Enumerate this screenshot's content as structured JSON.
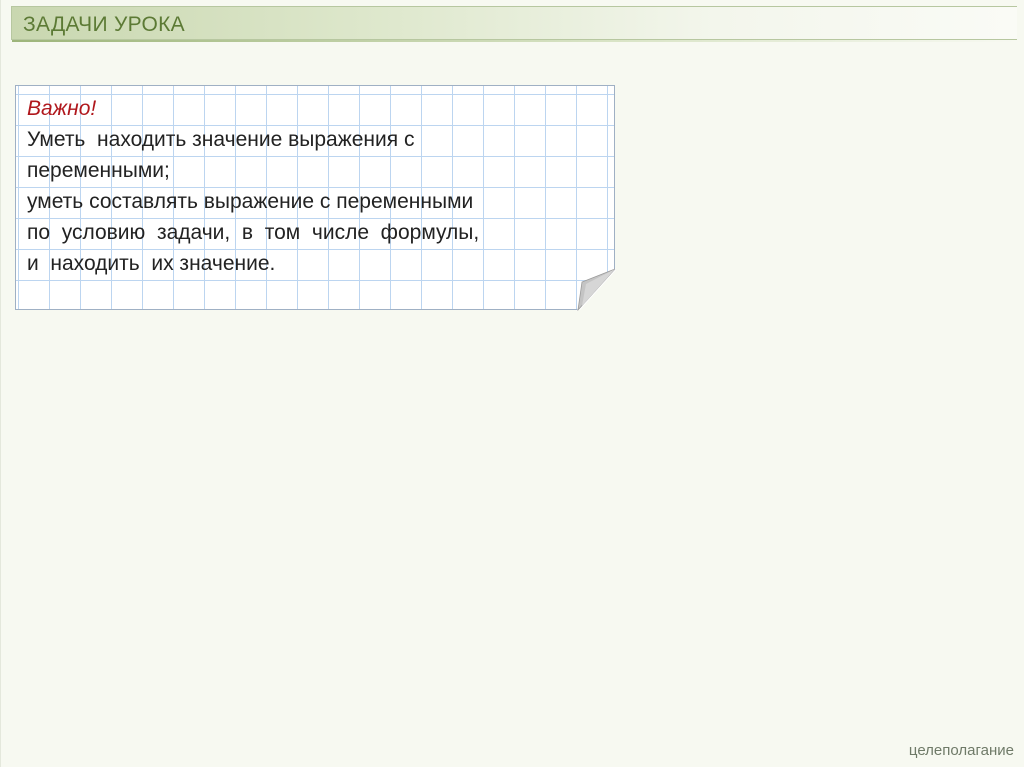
{
  "header": {
    "title": "ЗАДАЧИ УРОКА"
  },
  "note": {
    "important_label": "Важно!",
    "lines": [
      "Уметь  находить значение выражения с",
      "переменными;",
      "уметь составлять выражение с переменными",
      "по  условию  задачи,  в  том  числе  формулы,",
      "и  находить  их значение."
    ]
  },
  "footer": {
    "label": "целеполагание"
  },
  "colors": {
    "title_text": "#5c7a35",
    "important_text": "#b0171c",
    "grid_line": "#bcd5f0",
    "background": "#f7f9f1"
  }
}
